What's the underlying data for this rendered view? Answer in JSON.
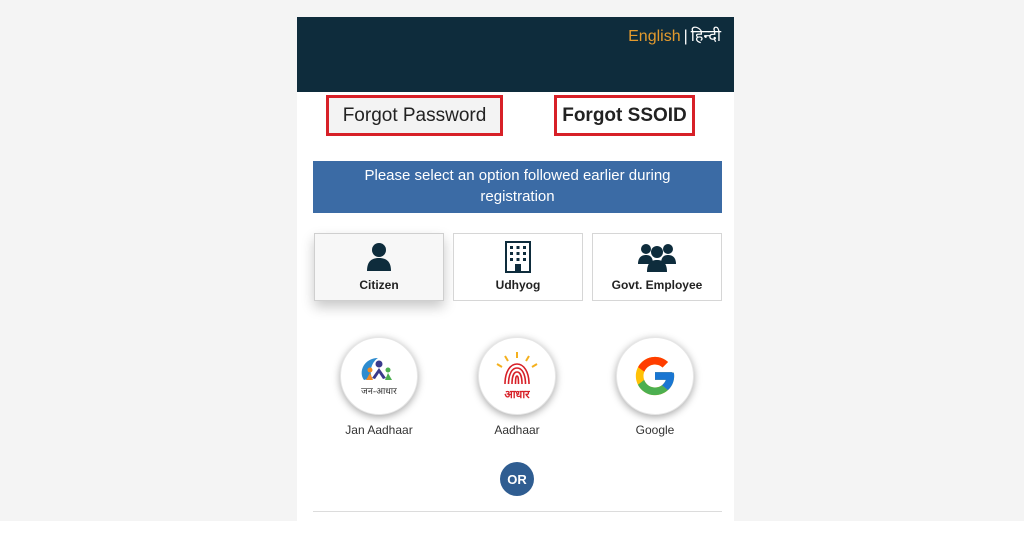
{
  "language": {
    "english": "English",
    "separator": "|",
    "hindi": "हिन्दी"
  },
  "tabs": {
    "forgot_password": "Forgot Password",
    "forgot_ssoid": "Forgot SSOID"
  },
  "banner": {
    "line1": "Please select an option followed earlier during",
    "line2": "registration"
  },
  "options": [
    {
      "label": "Citizen",
      "icon": "person-icon",
      "selected": true
    },
    {
      "label": "Udhyog",
      "icon": "building-icon",
      "selected": false
    },
    {
      "label": "Govt. Employee",
      "icon": "group-icon",
      "selected": false
    }
  ],
  "logins": [
    {
      "label": "Jan Aadhaar",
      "logo_text": "जन-आधार",
      "icon": "jan-aadhaar-logo"
    },
    {
      "label": "Aadhaar",
      "logo_text": "आधार",
      "icon": "aadhaar-logo"
    },
    {
      "label": "Google",
      "icon": "google-logo"
    }
  ],
  "or_label": "OR",
  "colors": {
    "header": "#0e2c3c",
    "accent_orange": "#e39a2d",
    "banner": "#3b6ba5",
    "highlight_red": "#d72027",
    "or_circle": "#2f5d91"
  }
}
